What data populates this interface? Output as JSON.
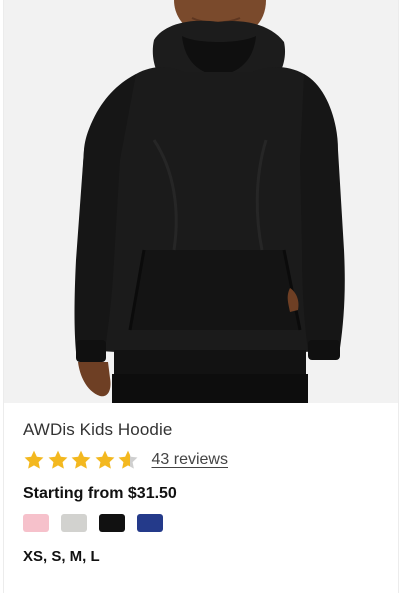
{
  "product": {
    "image_alt": "Kids black hoodie product photo",
    "title": "AWDis Kids Hoodie",
    "rating": 4.6,
    "rating_max": 5,
    "reviews_label": "43 reviews",
    "price_label": "Starting from $31.50",
    "sizes_label": "XS, S, M, L",
    "swatches": [
      {
        "color": "#f6c1cb"
      },
      {
        "color": "#d2d2cf"
      },
      {
        "color": "#111111"
      },
      {
        "color": "#243a8a"
      }
    ],
    "star_color": "#f3b81f",
    "star_empty_color": "#cfcfcf"
  }
}
